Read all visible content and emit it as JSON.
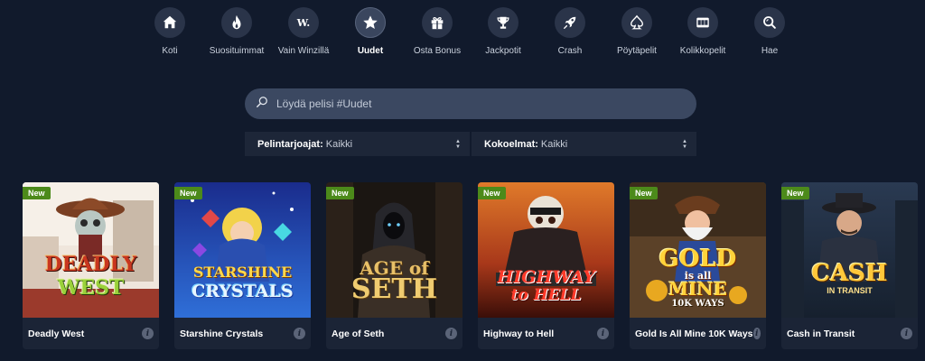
{
  "nav": {
    "items": [
      {
        "label": "Koti",
        "icon": "home-icon"
      },
      {
        "label": "Suosituimmat",
        "icon": "flame-icon"
      },
      {
        "label": "Vain Winzillä",
        "icon": "winz-logo-icon"
      },
      {
        "label": "Uudet",
        "icon": "star-icon",
        "active": true
      },
      {
        "label": "Osta Bonus",
        "icon": "gift-icon"
      },
      {
        "label": "Jackpotit",
        "icon": "trophy-icon"
      },
      {
        "label": "Crash",
        "icon": "rocket-icon"
      },
      {
        "label": "Pöytäpelit",
        "icon": "spade-icon"
      },
      {
        "label": "Kolikkopelit",
        "icon": "slot-machine-icon"
      },
      {
        "label": "Hae",
        "icon": "search-icon"
      }
    ],
    "winz_logo_text": "W."
  },
  "search": {
    "placeholder": "Löydä pelisi #Uudet"
  },
  "filters": {
    "provider_label": "Pelintarjoajat:",
    "provider_value": "Kaikki",
    "collection_label": "Kokoelmat:",
    "collection_value": "Kaikki"
  },
  "games": [
    {
      "title": "Deadly West",
      "badge": "New",
      "art_line1": "DEADLY",
      "art_line2": "WEST"
    },
    {
      "title": "Starshine Crystals",
      "badge": "New",
      "art_line1": "STARSHINE",
      "art_line2": "CRYSTALS"
    },
    {
      "title": "Age of Seth",
      "badge": "New",
      "art_line1": "AGE of",
      "art_line2": "SETH"
    },
    {
      "title": "Highway to Hell",
      "badge": "New",
      "art_line1": "HIGHWAY",
      "art_line2": "to HELL"
    },
    {
      "title": "Gold Is All Mine 10K Ways",
      "badge": "New",
      "art_line1": "GOLD",
      "art_line2": "is all",
      "art_line3": "MINE",
      "art_line4": "10K WAYS"
    },
    {
      "title": "Cash in Transit",
      "badge": "New",
      "art_line1": "CASH",
      "art_line2": "IN TRANSIT"
    }
  ],
  "info_glyph": "i",
  "colors": {
    "background": "#111a2c",
    "nav_circle": "#2a3449",
    "search_bg": "#3b4861",
    "badge_green": "#4c8a1a",
    "card_bg": "#1b2436"
  }
}
